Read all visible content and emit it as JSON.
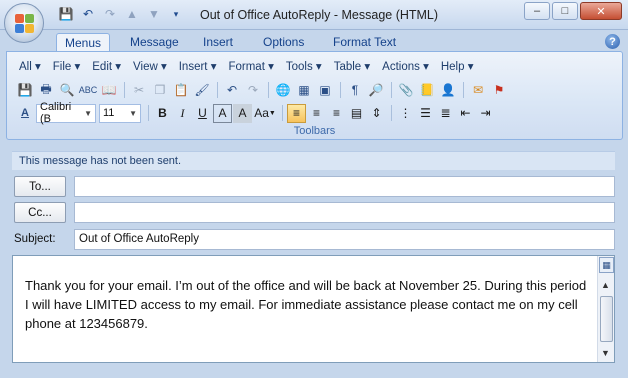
{
  "window": {
    "title": "Out of Office AutoReply - Message (HTML)",
    "controls": {
      "minimize": "–",
      "maximize": "□",
      "close": "✕"
    }
  },
  "quick_access": [
    {
      "name": "save-icon",
      "glyph": "💾"
    },
    {
      "name": "undo-icon",
      "glyph": "↶"
    },
    {
      "name": "redo-icon",
      "glyph": "↷"
    },
    {
      "name": "up-arrow-icon",
      "glyph": "⬆"
    },
    {
      "name": "down-arrow-icon",
      "glyph": "⬇"
    },
    {
      "name": "customize-qat-icon",
      "glyph": "▾"
    }
  ],
  "tabs": [
    {
      "label": "Menus",
      "active": true
    },
    {
      "label": "Message",
      "active": false
    },
    {
      "label": "Insert",
      "active": false
    },
    {
      "label": "Options",
      "active": false
    },
    {
      "label": "Format Text",
      "active": false
    }
  ],
  "menus": [
    "All",
    "File",
    "Edit",
    "View",
    "Insert",
    "Format",
    "Tools",
    "Table",
    "Actions",
    "Help"
  ],
  "format": {
    "font_name": "Calibri (B",
    "font_size": "11",
    "bold": "B",
    "italic": "I",
    "underline": "U",
    "font_color": "A",
    "highlight": "A",
    "change_case": "Aa"
  },
  "ribbon_group_label": "Toolbars",
  "info_bar": "This message has not been sent.",
  "address": {
    "to_button": "To...",
    "to_value": "",
    "cc_button": "Cc...",
    "cc_value": "",
    "subject_label": "Subject:",
    "subject_value": "Out of Office AutoReply"
  },
  "message_body": "Thank you for your email.  I’m out of the office and will be back at November 25.  During this period I will have LIMITED access to my email. For immediate assistance please contact me on my cell phone at 123456879.",
  "colors": {
    "office_blue": "#15428b",
    "ribbon_border": "#8db2e3",
    "selected_highlight": "#f7c35d"
  }
}
